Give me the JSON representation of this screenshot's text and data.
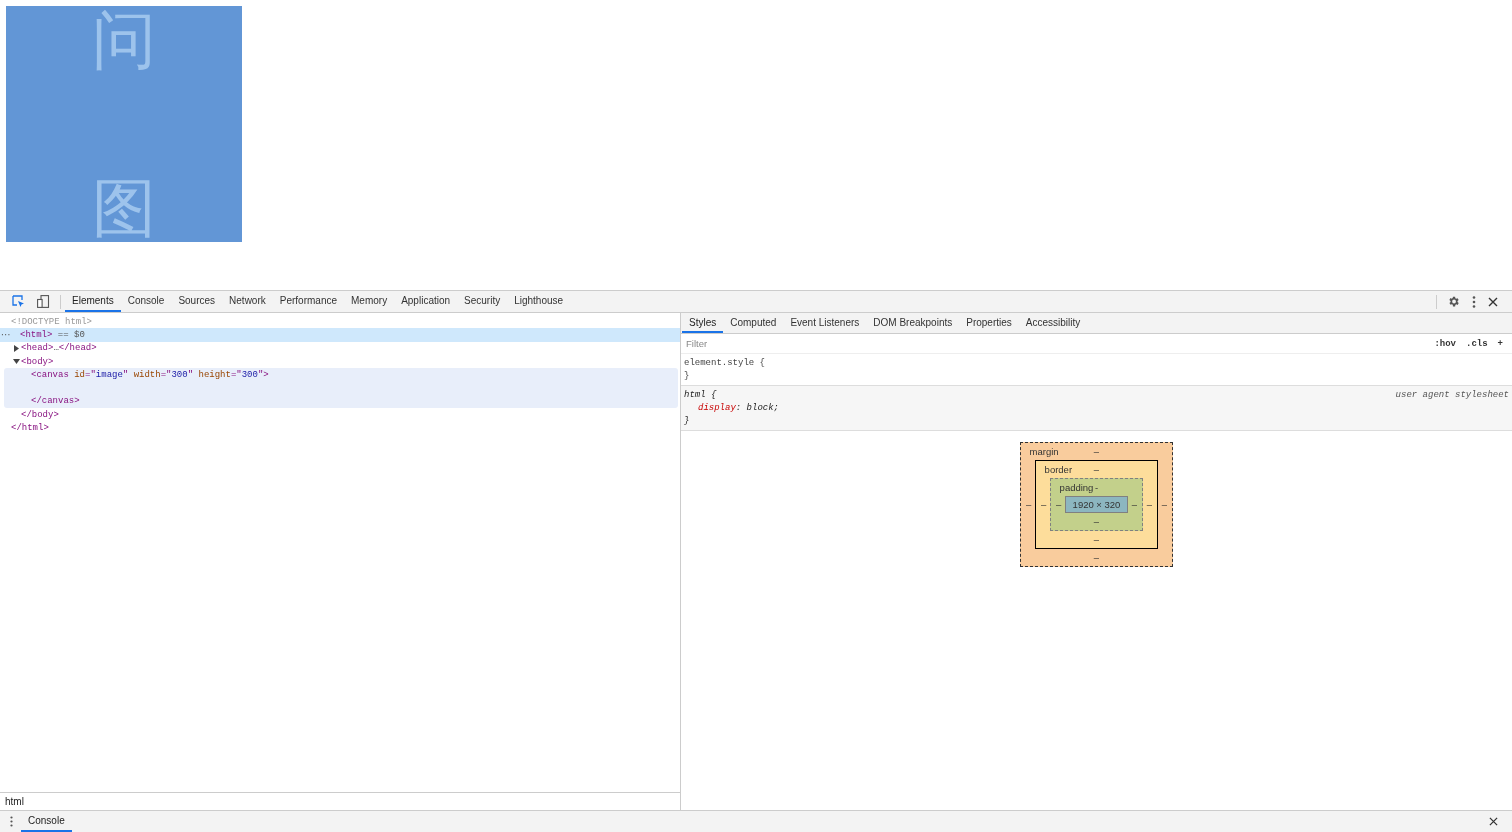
{
  "page": {
    "canvas": {
      "texts": [
        "问",
        "图"
      ]
    }
  },
  "devtools": {
    "toolbar": {
      "tabs": [
        {
          "label": "Elements",
          "selected": true
        },
        {
          "label": "Console",
          "selected": false
        },
        {
          "label": "Sources",
          "selected": false
        },
        {
          "label": "Network",
          "selected": false
        },
        {
          "label": "Performance",
          "selected": false
        },
        {
          "label": "Memory",
          "selected": false
        },
        {
          "label": "Application",
          "selected": false
        },
        {
          "label": "Security",
          "selected": false
        },
        {
          "label": "Lighthouse",
          "selected": false
        }
      ]
    },
    "dom_tree": [
      {
        "selected": false,
        "segments": [
          {
            "kind": "doctype",
            "text": "<!DOCTYPE html>"
          }
        ]
      },
      {
        "selected": true,
        "marker": "···",
        "segments": [
          {
            "kind": "tag",
            "text": "<html>"
          },
          {
            "kind": "plain",
            "text": " == $0"
          }
        ],
        "close": [
          {
            "kind": "tag",
            "text": "</html>"
          }
        ],
        "children": [
          {
            "expanded": false,
            "selected": false,
            "segments": [
              {
                "kind": "tag",
                "text": "<head>"
              },
              {
                "kind": "plain",
                "text": "…"
              },
              {
                "kind": "tag",
                "text": "</head>"
              }
            ]
          },
          {
            "expanded": true,
            "selected": false,
            "segments": [
              {
                "kind": "tag",
                "text": "<body>"
              }
            ],
            "close": [
              {
                "kind": "tag",
                "text": "</body>"
              }
            ],
            "children": [
              {
                "selected": false,
                "hovered": true,
                "blank_line": true,
                "segments": [
                  {
                    "kind": "tag",
                    "text": "<canvas"
                  },
                  {
                    "kind": "attr-name",
                    "text": " id"
                  },
                  {
                    "kind": "tag",
                    "text": "=\""
                  },
                  {
                    "kind": "attr-value",
                    "text": "image"
                  },
                  {
                    "kind": "tag",
                    "text": "\""
                  },
                  {
                    "kind": "attr-name",
                    "text": " width"
                  },
                  {
                    "kind": "tag",
                    "text": "=\""
                  },
                  {
                    "kind": "attr-value",
                    "text": "300"
                  },
                  {
                    "kind": "tag",
                    "text": "\""
                  },
                  {
                    "kind": "attr-name",
                    "text": " height"
                  },
                  {
                    "kind": "tag",
                    "text": "=\""
                  },
                  {
                    "kind": "attr-value",
                    "text": "300"
                  },
                  {
                    "kind": "tag",
                    "text": "\">"
                  }
                ],
                "close": [
                  {
                    "kind": "tag",
                    "text": "</canvas>"
                  }
                ]
              }
            ]
          }
        ]
      }
    ],
    "breadcrumb": "html",
    "sidebar": {
      "tabs": [
        {
          "label": "Styles",
          "selected": true
        },
        {
          "label": "Computed",
          "selected": false
        },
        {
          "label": "Event Listeners",
          "selected": false
        },
        {
          "label": "DOM Breakpoints",
          "selected": false
        },
        {
          "label": "Properties",
          "selected": false
        },
        {
          "label": "Accessibility",
          "selected": false
        }
      ],
      "filter": {
        "placeholder": "Filter"
      },
      "filter_buttons": [
        ":hov",
        ".cls",
        "+"
      ],
      "rules": [
        {
          "selector": "element.style {",
          "close": "}"
        },
        {
          "selector": "html {",
          "origin": "user agent stylesheet",
          "declarations": [
            {
              "property": "display",
              "value": ": block;"
            }
          ],
          "close": "}"
        }
      ],
      "box_model": {
        "layers": [
          {
            "kind": "margin",
            "label": "margin",
            "top": "–"
          },
          {
            "kind": "border",
            "label": "border",
            "top": "–"
          },
          {
            "kind": "padding",
            "label": "padding",
            "top": "-"
          }
        ],
        "left_values": [
          "–",
          "–",
          "–"
        ],
        "content": "1920 × 320",
        "right_values": [
          "–",
          "–",
          "–"
        ],
        "bottom_values": [
          "–",
          "–",
          "–"
        ]
      }
    },
    "drawer": {
      "tabs": [
        {
          "label": "Console",
          "selected": true
        }
      ]
    }
  }
}
